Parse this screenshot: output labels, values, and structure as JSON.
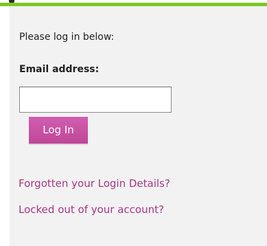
{
  "theme": {
    "accent": "#7ac91f",
    "panel_background": "#f2f2f2",
    "button_color": "#c54d9f",
    "link_color": "#a63687"
  },
  "login": {
    "intro": "Please log in below:",
    "email_label": "Email address:",
    "email_value": "",
    "email_placeholder": "",
    "submit_label": "Log In"
  },
  "links": {
    "forgotten_details": "Forgotten your Login Details?",
    "locked_out": "Locked out of your account?"
  }
}
